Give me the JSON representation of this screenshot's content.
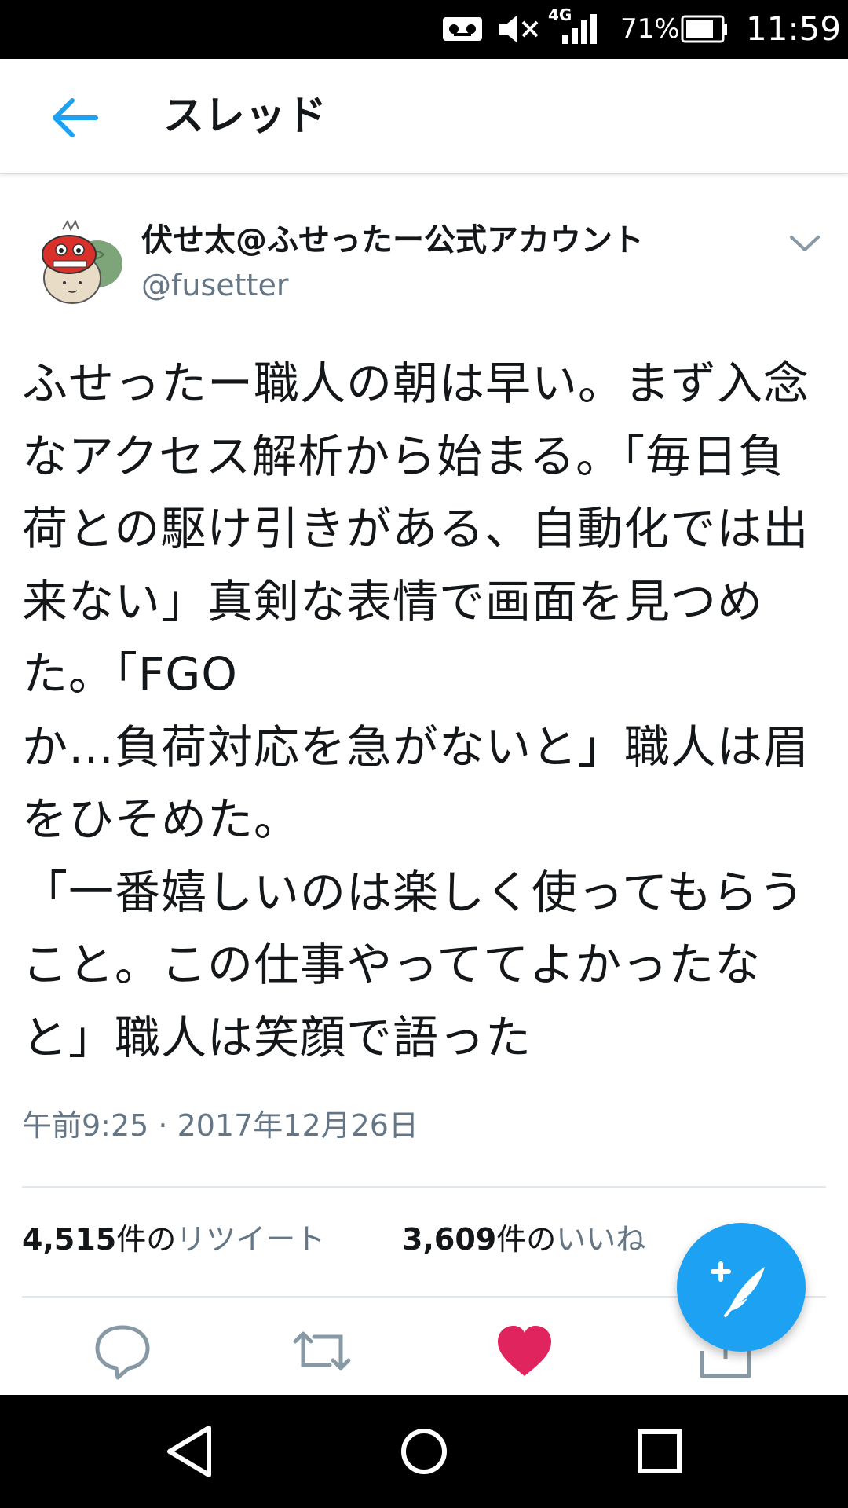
{
  "status_bar": {
    "network_label": "4G",
    "battery_text": "71%",
    "time": "11:59",
    "icons": [
      "voicemail-icon",
      "mute-icon",
      "signal-icon",
      "battery-icon"
    ]
  },
  "app_bar": {
    "back_icon": "arrow-left-icon",
    "title": "スレッド"
  },
  "tweet": {
    "display_name": "伏せ太@ふせったー公式アカウント",
    "handle": "@fusetter",
    "caret_icon": "chevron-down-icon",
    "text": "ふせったー職人の朝は早い。まず入念なアクセス解析から始まる。「毎日負荷との駆け引きがある、自動化では出来ない」真剣な表情で画面を見つめた。「FGO\nか…負荷対応を急がないと」職人は眉をひそめた。\n「一番嬉しいのは楽しく使ってもらうこと。この仕事やっててよかったなと」職人は笑顔で語った",
    "timestamp": "午前9:25 · 2017年12月26日",
    "retweets": {
      "count": "4,515",
      "unit": "件の",
      "label": "リツイート"
    },
    "likes": {
      "count": "3,609",
      "unit": "件の",
      "label": "いいね"
    }
  },
  "actions": [
    {
      "name": "reply-icon"
    },
    {
      "name": "retweet-icon"
    },
    {
      "name": "like-icon",
      "active": true,
      "color": "#e0245e"
    },
    {
      "name": "share-icon"
    }
  ],
  "fab": {
    "icon": "compose-tweet-icon",
    "color": "#1da1f2"
  },
  "nav_bar": {
    "buttons": [
      "back-triangle-icon",
      "home-circle-icon",
      "recents-square-icon"
    ]
  },
  "colors": {
    "accent": "#1da1f2",
    "like": "#e0245e",
    "secondary_text": "#657786",
    "divider": "#e1e8ed"
  }
}
